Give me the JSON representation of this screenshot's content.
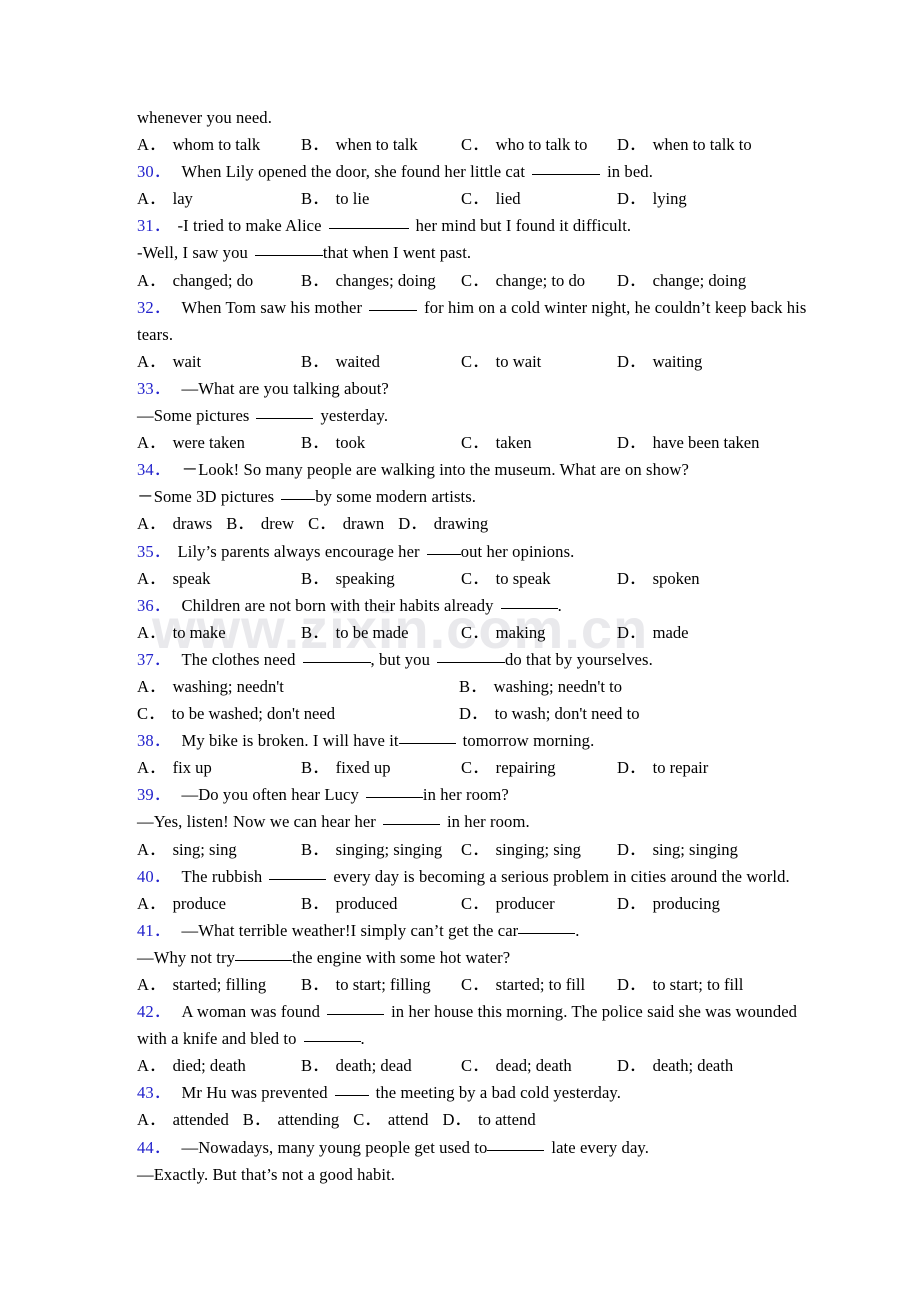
{
  "page": {
    "watermark": "www.zixin.com.cn",
    "number_color": "#2222cc",
    "text_color": "#000000",
    "background": "#ffffff"
  },
  "lines": {
    "carryover_stem": "whenever you need.",
    "q29_options": [
      {
        "label": "A",
        "text": "whom to talk"
      },
      {
        "label": "B",
        "text": "when to talk"
      },
      {
        "label": "C",
        "text": "who to talk to"
      },
      {
        "label": "D",
        "text": "when to talk to"
      }
    ]
  },
  "questions": [
    {
      "number": "30",
      "stem_a": "When Lily opened the door, she found her little cat",
      "stem_b": "in bed.",
      "options": [
        {
          "label": "A",
          "text": "lay"
        },
        {
          "label": "B",
          "text": "to lie"
        },
        {
          "label": "C",
          "text": "lied"
        },
        {
          "label": "D",
          "text": "lying"
        }
      ]
    },
    {
      "number": "31",
      "stem_a": "-I tried to make Alice",
      "stem_b": "her mind but I found it difficult.",
      "stem2_a": "-Well, I saw you",
      "stem2_b": "that when I went past.",
      "options": [
        {
          "label": "A",
          "text": "changed; do"
        },
        {
          "label": "B",
          "text": "changes; doing"
        },
        {
          "label": "C",
          "text": "change; to do"
        },
        {
          "label": "D",
          "text": "change; doing"
        }
      ]
    },
    {
      "number": "32",
      "stem_a": "When Tom saw his mother",
      "stem_b": "for him on a cold winter night, he couldn’t keep back his",
      "stem_c": "tears.",
      "options": [
        {
          "label": "A",
          "text": "wait"
        },
        {
          "label": "B",
          "text": "waited"
        },
        {
          "label": "C",
          "text": "to wait"
        },
        {
          "label": "D",
          "text": "waiting"
        }
      ]
    },
    {
      "number": "33",
      "stem_a": "—What are you talking about?",
      "stem2_a": "—Some pictures",
      "stem2_b": "yesterday.",
      "options": [
        {
          "label": "A",
          "text": "were taken"
        },
        {
          "label": "B",
          "text": "took"
        },
        {
          "label": "C",
          "text": "taken"
        },
        {
          "label": "D",
          "text": "have been taken"
        }
      ]
    },
    {
      "number": "34",
      "stem_a": "－Look! So many people are walking into the museum. What are on show?",
      "stem2_a": "－Some 3D pictures",
      "stem2_b": "by some modern artists.",
      "options": [
        {
          "label": "A",
          "text": "draws"
        },
        {
          "label": "B",
          "text": "drew"
        },
        {
          "label": "C",
          "text": "drawn"
        },
        {
          "label": "D",
          "text": "drawing"
        }
      ]
    },
    {
      "number": "35",
      "stem_a": "Lily’s parents always encourage her",
      "stem_b": "out her opinions.",
      "options": [
        {
          "label": "A",
          "text": "speak"
        },
        {
          "label": "B",
          "text": "speaking"
        },
        {
          "label": "C",
          "text": "to speak"
        },
        {
          "label": "D",
          "text": "spoken"
        }
      ]
    },
    {
      "number": "36",
      "stem_a": "Children are not born with their habits already",
      "stem_b": ".",
      "options": [
        {
          "label": "A",
          "text": "to make"
        },
        {
          "label": "B",
          "text": "to be made"
        },
        {
          "label": "C",
          "text": "making"
        },
        {
          "label": "D",
          "text": "made"
        }
      ]
    },
    {
      "number": "37",
      "stem_a": "The clothes need",
      "stem_b": ", but you",
      "stem_c": "do that by yourselves.",
      "options": [
        {
          "label": "A",
          "text": "washing; needn't"
        },
        {
          "label": "B",
          "text": "washing; needn't to"
        },
        {
          "label": "C",
          "text": "to be washed; don't need"
        },
        {
          "label": "D",
          "text": "to wash; don't need to"
        }
      ]
    },
    {
      "number": "38",
      "stem_a": "My bike is broken. I will have it",
      "stem_b": "tomorrow morning.",
      "options": [
        {
          "label": "A",
          "text": "fix up"
        },
        {
          "label": "B",
          "text": "fixed up"
        },
        {
          "label": "C",
          "text": "repairing"
        },
        {
          "label": "D",
          "text": "to repair"
        }
      ]
    },
    {
      "number": "39",
      "stem_a": "—Do you often hear Lucy",
      "stem_b": "in her room?",
      "stem2_a": "—Yes, listen! Now we can hear her",
      "stem2_b": "in her room.",
      "options": [
        {
          "label": "A",
          "text": "sing; sing"
        },
        {
          "label": "B",
          "text": "singing; singing"
        },
        {
          "label": "C",
          "text": "singing; sing"
        },
        {
          "label": "D",
          "text": "sing; singing"
        }
      ]
    },
    {
      "number": "40",
      "stem_a": "The rubbish",
      "stem_b": "every day is becoming a serious problem in cities around the world.",
      "options": [
        {
          "label": "A",
          "text": "produce"
        },
        {
          "label": "B",
          "text": "produced"
        },
        {
          "label": "C",
          "text": "producer"
        },
        {
          "label": "D",
          "text": "producing"
        }
      ]
    },
    {
      "number": "41",
      "stem_a": "—What terrible weather!I simply can’t get the car",
      "stem_b": ".",
      "stem2_a": "—Why not try",
      "stem2_b": "the engine with some hot water?",
      "options": [
        {
          "label": "A",
          "text": "started; filling"
        },
        {
          "label": "B",
          "text": "to start; filling"
        },
        {
          "label": "C",
          "text": "started; to fill"
        },
        {
          "label": "D",
          "text": "to start; to fill"
        }
      ]
    },
    {
      "number": "42",
      "stem_a": "A woman was found",
      "stem_b": "in her house this morning. The police said she was wounded",
      "stem2_a": "with a knife and bled to",
      "stem2_b": ".",
      "options": [
        {
          "label": "A",
          "text": "died; death"
        },
        {
          "label": "B",
          "text": "death; dead"
        },
        {
          "label": "C",
          "text": "dead; death"
        },
        {
          "label": "D",
          "text": "death; death"
        }
      ]
    },
    {
      "number": "43",
      "stem_a": "Mr Hu was prevented",
      "stem_b": "the meeting by a bad cold yesterday.",
      "options": [
        {
          "label": "A",
          "text": "attended"
        },
        {
          "label": "B",
          "text": "attending"
        },
        {
          "label": "C",
          "text": "attend"
        },
        {
          "label": "D",
          "text": "to attend"
        }
      ]
    },
    {
      "number": "44",
      "stem_a": "—Nowadays, many young people get used to",
      "stem_b": "late every day.",
      "stem2_a": "—Exactly. But that’s not a good habit."
    }
  ]
}
